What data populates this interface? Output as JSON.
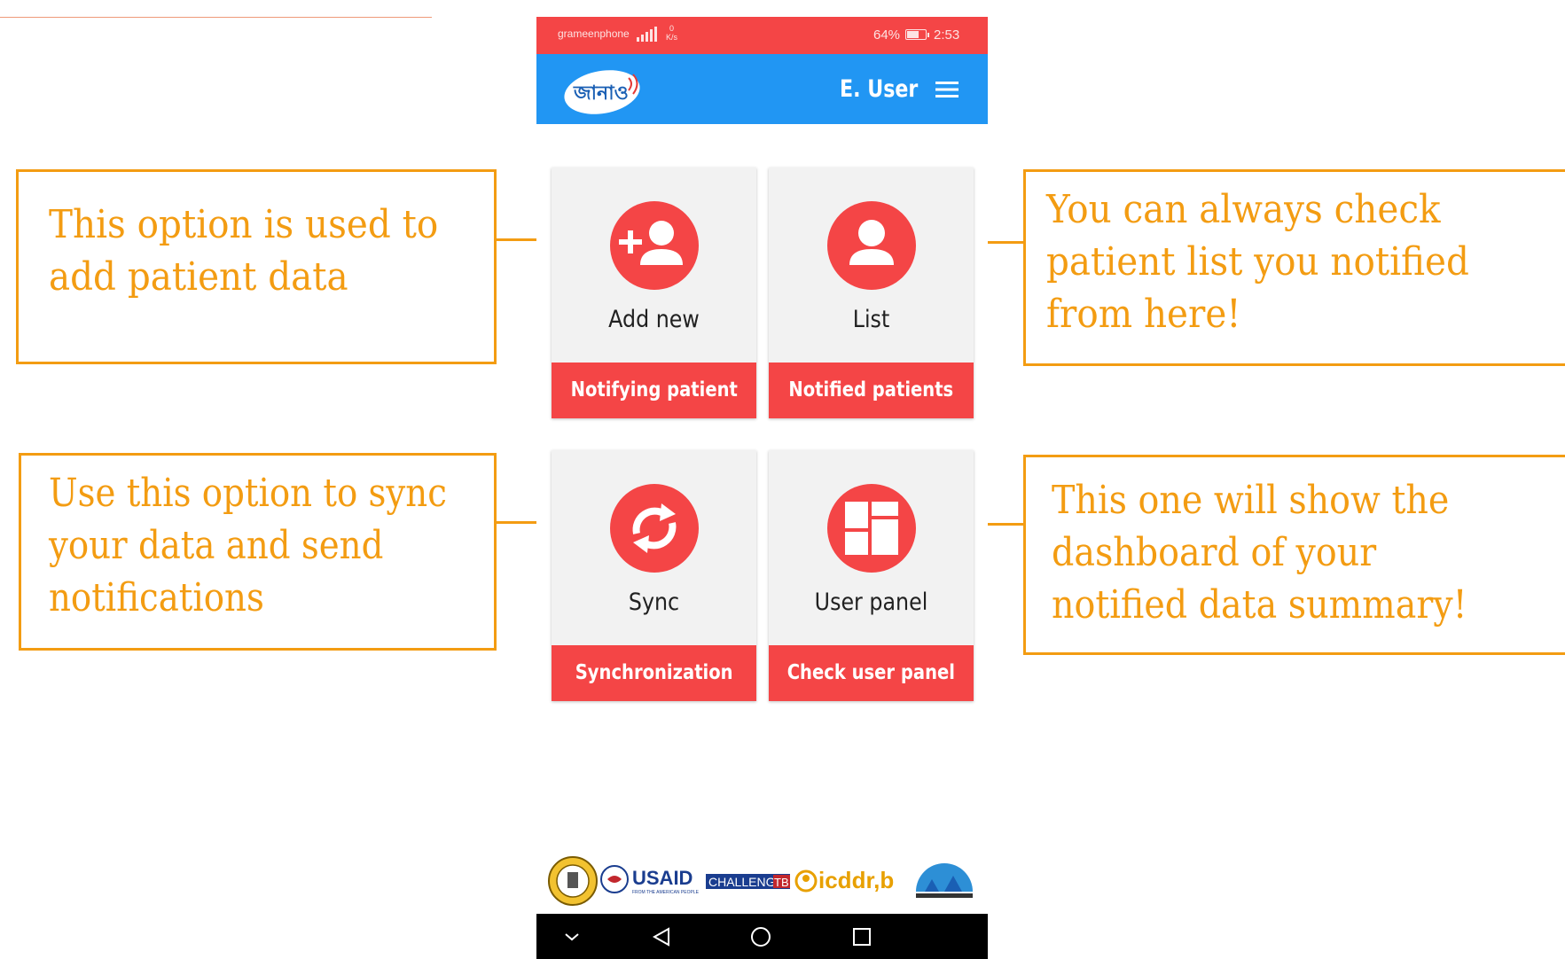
{
  "statusbar": {
    "carrier": "grameenphone",
    "speed_value": "0",
    "speed_unit": "K/s",
    "battery": "64%",
    "time": "2:53"
  },
  "appbar": {
    "logo_text": "জানাও",
    "user_name": "E. User"
  },
  "cards": [
    {
      "title": "Add new",
      "button": "Notifying patient",
      "icon": "add-user-icon"
    },
    {
      "title": "List",
      "button": "Notified patients",
      "icon": "person-icon"
    },
    {
      "title": "Sync",
      "button": "Synchronization",
      "icon": "sync-icon"
    },
    {
      "title": "User panel",
      "button": "Check user panel",
      "icon": "dashboard-icon"
    }
  ],
  "partners": {
    "usaid": "USAID",
    "usaid_tagline": "FROM THE AMERICAN PEOPLE",
    "challenge": "CHALLENGE",
    "tb": "TB",
    "icddrb": "icddr,b"
  },
  "callouts": {
    "add_new": [
      "This option is used to",
      "add patient data"
    ],
    "list": [
      "You can always check",
      "patient list you notified",
      "from here!"
    ],
    "sync": [
      "Use this option to sync",
      "your data and send",
      "notifications"
    ],
    "user_panel": [
      "This one will show the",
      "dashboard of your",
      "notified data summary!"
    ]
  },
  "colors": {
    "status_bar": "#f44546",
    "app_bar": "#2196f3",
    "accent_red": "#f44546",
    "callout_orange": "#f39c12"
  }
}
